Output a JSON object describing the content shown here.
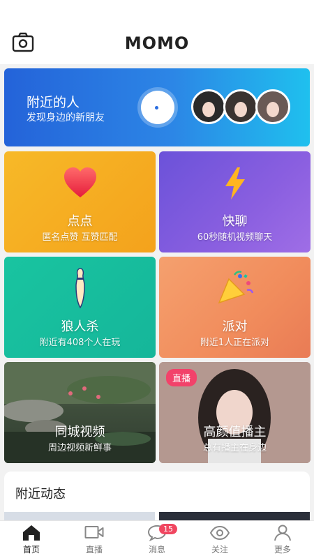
{
  "header": {
    "logo": "MOMO",
    "camera_icon": "camera-icon"
  },
  "banner": {
    "title": "附近的人",
    "subtitle": "发现身边的新朋友"
  },
  "tiles": {
    "dian": {
      "title": "点点",
      "subtitle": "匿名点赞 互赞匹配",
      "icon": "heart-icon"
    },
    "kuai": {
      "title": "快聊",
      "subtitle": "60秒随机视频聊天",
      "icon": "lightning-icon"
    },
    "lang": {
      "title": "狼人杀",
      "subtitle": "附近有408个人在玩",
      "icon": "bowling-pin-icon"
    },
    "pai": {
      "title": "派对",
      "subtitle": "附近1人正在派对",
      "icon": "party-popper-icon"
    },
    "tong": {
      "title": "同城视频",
      "subtitle": "周边视频新鲜事"
    },
    "gao": {
      "title": "高颜值播主",
      "subtitle": "总有播主在身边",
      "badge": "直播"
    }
  },
  "feed": {
    "title": "附近动态"
  },
  "nav": {
    "items": [
      {
        "label": "首页",
        "icon": "home-icon",
        "active": true
      },
      {
        "label": "直播",
        "icon": "video-camera-icon"
      },
      {
        "label": "消息",
        "icon": "chat-bubble-icon",
        "badge": "15"
      },
      {
        "label": "关注",
        "icon": "eye-icon"
      },
      {
        "label": "更多",
        "icon": "user-icon"
      }
    ]
  },
  "colors": {
    "banner_start": "#2463d9",
    "banner_end": "#1fc0ee",
    "dian": "#f7b928",
    "kuai": "#7b58dc",
    "lang": "#19c4a0",
    "pai": "#f18c5c",
    "live_badge": "#f2426a",
    "msg_badge": "#f04660"
  }
}
